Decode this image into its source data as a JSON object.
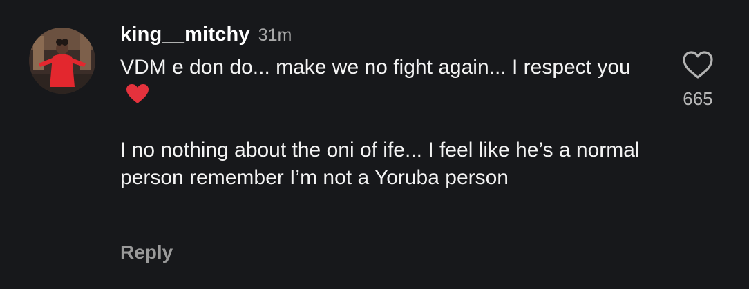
{
  "comment": {
    "username": "king__mitchy",
    "time": "31m",
    "paragraph1": "VDM e don do... make we no fight again... I respect you",
    "paragraph2": "I no nothing about the oni of ife... I feel like he’s a normal person remember I’m not a Yoruba person",
    "reply_label": "Reply",
    "like_count": "665",
    "icons": {
      "avatar": "avatar-image",
      "heart_emoji": "red-heart-emoji",
      "like": "heart-outline-icon"
    },
    "colors": {
      "background": "#17181b",
      "heart_emoji": "#e5323d",
      "username": "#ffffff",
      "muted": "#a8a8a8"
    }
  }
}
